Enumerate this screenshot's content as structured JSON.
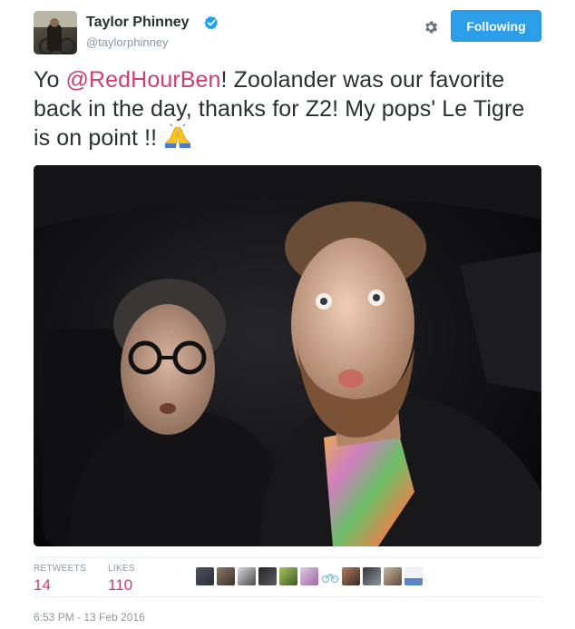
{
  "author": {
    "name": "Taylor Phinney",
    "handle": "@taylorphinney",
    "verified": true,
    "avatar_icon": "cyclist-avatar"
  },
  "actions": {
    "follow_label": "Following",
    "settings_icon": "gear-icon"
  },
  "tweet": {
    "text_before": "Yo ",
    "mention": "@RedHourBen",
    "text_after": "! Zoolander was our favorite back in the day, thanks for Z2! My pops' Le Tigre is on point !! ",
    "emoji": "folded-hands-emoji",
    "media": "photo-two-men-in-car-selfie"
  },
  "stats": {
    "retweets_label": "RETWEETS",
    "retweets": "14",
    "likes_label": "LIKES",
    "likes": "110",
    "liker_avatars": [
      "liker-1",
      "liker-2",
      "liker-3",
      "liker-4",
      "liker-5",
      "liker-6",
      "liker-7",
      "liker-8",
      "liker-9",
      "liker-10",
      "liker-11"
    ]
  },
  "timestamp": "6:53 PM - 13 Feb 2016",
  "colors": {
    "accent": "#2b9de9",
    "mention": "#ce3d6f",
    "muted": "#8899a6",
    "text": "#292f33"
  }
}
